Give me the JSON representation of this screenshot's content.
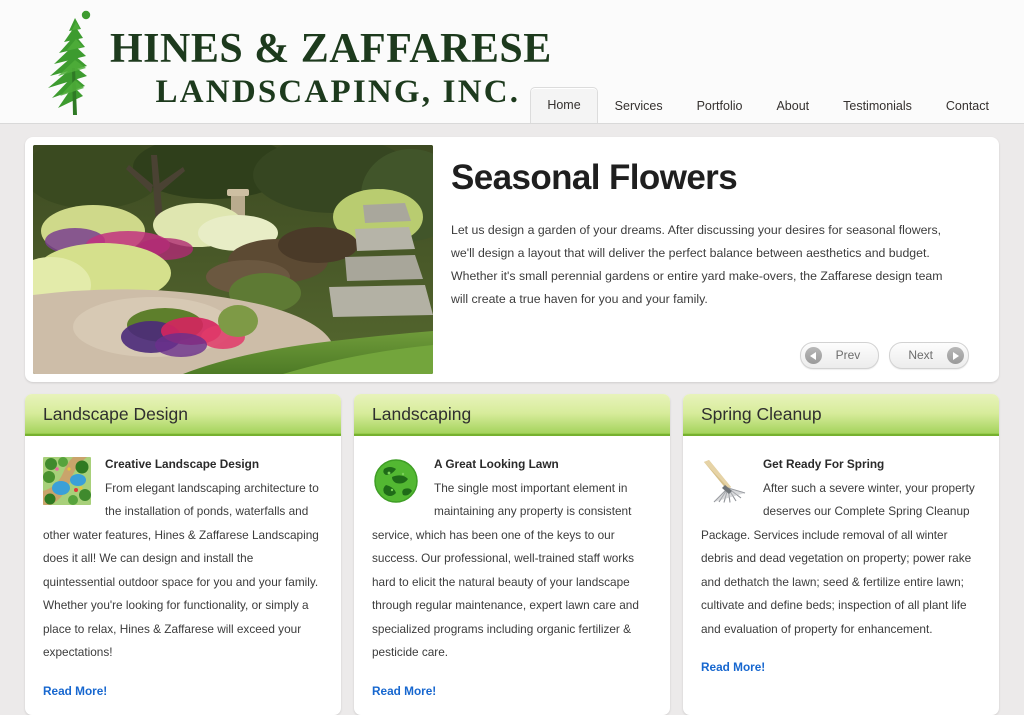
{
  "header": {
    "logo": {
      "icon": "pine-tree-icon",
      "line1_a": "H",
      "line1": "INES",
      "amp": "&",
      "line1_b": "Z",
      "line1_c": "AFFARESE",
      "full_line1": "HINES & ZAFFARESE",
      "full_line2": "LANDSCAPING, INC."
    },
    "nav": [
      {
        "label": "Home",
        "active": true
      },
      {
        "label": "Services",
        "active": false
      },
      {
        "label": "Portfolio",
        "active": false
      },
      {
        "label": "About",
        "active": false
      },
      {
        "label": "Testimonials",
        "active": false
      },
      {
        "label": "Contact",
        "active": false
      }
    ]
  },
  "hero": {
    "image_alt": "garden-with-seasonal-flowers-and-stone-path",
    "title": "Seasonal Flowers",
    "body": "Let us design a garden of your dreams. After discussing your desires for seasonal flowers, we'll design a layout that will deliver the perfect balance between aesthetics and budget. Whether it's small perennial gardens or entire yard make-overs, the Zaffarese design team will create a true haven for you and your family.",
    "prev_label": "Prev",
    "next_label": "Next"
  },
  "cards": [
    {
      "title": "Landscape Design",
      "thumb": "landscape-plan-thumbnail",
      "lead": "Creative Landscape Design",
      "body": "From elegant landscaping architecture to the installation of ponds, waterfalls and other water features, Hines & Zaffarese Landscaping does it all! We can design and install the quintessential outdoor space for you and your family. Whether you're looking for functionality, or simply a place to relax, Hines & Zaffarese will exceed your expectations!",
      "link": "Read More!"
    },
    {
      "title": "Landscaping",
      "thumb": "green-globe-thumbnail",
      "lead": "A Great Looking Lawn",
      "body": "The single most important element in maintaining any property is consistent service, which has been one of the keys to our success. Our professional, well-trained staff works hard to elicit the natural beauty of your landscape through regular maintenance, expert lawn care and specialized programs including organic fertilizer & pesticide care.",
      "link": "Read More!"
    },
    {
      "title": "Spring Cleanup",
      "thumb": "rake-thumbnail",
      "lead": "Get Ready For Spring",
      "body": "After such a severe winter, your property deserves our Complete Spring Cleanup Package. Services include removal of all winter debris and dead vegetation on property; power rake and dethatch the lawn; seed & fertilize entire lawn; cultivate and define beds; inspection of all plant life and evaluation of property for enhancement.",
      "link": "Read More!"
    }
  ],
  "colors": {
    "page_background": "#eceaea",
    "header_background": "#fbfbfb",
    "logo_green": "#1d3a1d",
    "card_header_green_top": "#e8f3bb",
    "card_header_green_bottom": "#8cc63f",
    "link_blue": "#1767cf"
  }
}
